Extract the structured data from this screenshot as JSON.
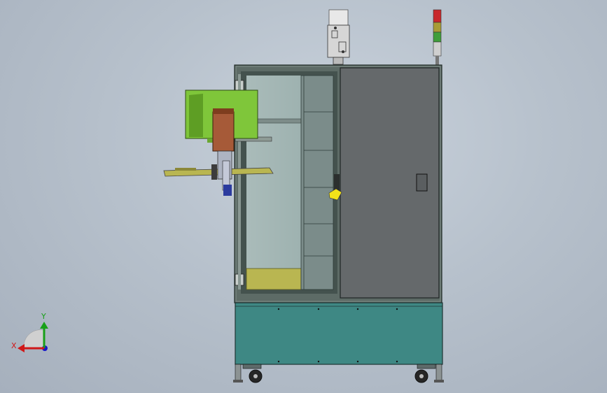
{
  "viewport": {
    "background_top": "#c9d2dc",
    "background_bottom": "#a6b0bd"
  },
  "model": {
    "frame_color": "#3f4f4a",
    "door_color": "#65696b",
    "glass_color": "#9eb2b0",
    "base_color": "#3e8884",
    "monitor_color": "#7fc63a",
    "shelf_color": "#b9b651",
    "arm_color": "#a65a38",
    "motor_color": "#d8d8d8",
    "tower_light_colors": [
      "#c8282b",
      "#a89c36",
      "#3f9e3a",
      "#cfcfcf"
    ]
  },
  "triad": {
    "x_label": "X",
    "y_label": "Y",
    "x_color": "#d01818",
    "y_color": "#18a018",
    "z_color": "#1818c8"
  }
}
